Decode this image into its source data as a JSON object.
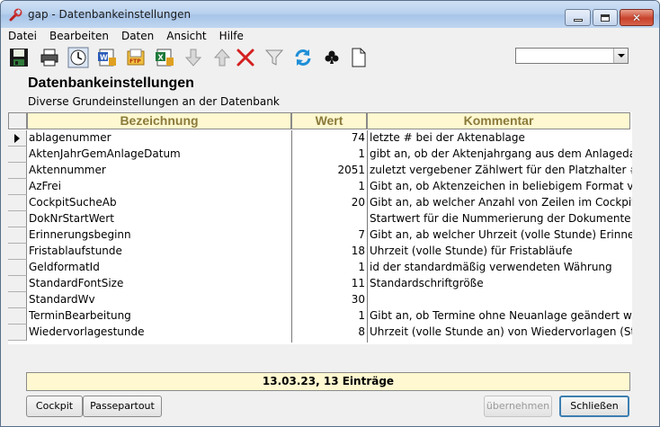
{
  "window": {
    "title": "gap - Datenbankeinstellungen",
    "icon": "wrench-icon"
  },
  "menu": [
    "Datei",
    "Bearbeiten",
    "Daten",
    "Ansicht",
    "Hilfe"
  ],
  "toolbar_icons": [
    "save-icon",
    "print-icon",
    "clock-icon",
    "word-export-icon",
    "ftp-icon",
    "excel-export-icon",
    "move-down-icon",
    "move-up-icon",
    "delete-icon",
    "filter-icon",
    "refresh-icon",
    "club-icon",
    "new-document-icon"
  ],
  "combo": {
    "value": ""
  },
  "page": {
    "title": "Datenbankeinstellungen",
    "subtitle": "Diverse Grundeinstellungen an der Datenbank"
  },
  "grid": {
    "columns": [
      "Bezeichnung",
      "Wert",
      "Kommentar"
    ],
    "rows": [
      {
        "name": "ablagenummer",
        "value": "74",
        "comment": "letzte # bei der Aktenablage"
      },
      {
        "name": "AktenJahrGemAnlageDatum",
        "value": "1",
        "comment": "gibt an, ob der Aktenjahrgang aus dem Anlagedatum"
      },
      {
        "name": "Aktennummer",
        "value": "2051",
        "comment": "zuletzt vergebener Zählwert für den Platzhalter # bei de"
      },
      {
        "name": "AzFrei",
        "value": "1",
        "comment": "Gibt an, ob Aktenzeichen in beliebigem Format verwer"
      },
      {
        "name": "CockpitSucheAb",
        "value": "20",
        "comment": "Gibt an, ab welcher Anzahl von Zeilen im Cockpit das"
      },
      {
        "name": "DokNrStartWert",
        "value": "",
        "comment": "Startwert für die Nummerierung der Dokumente im Ak"
      },
      {
        "name": "Erinnerungsbeginn",
        "value": "7",
        "comment": "Gibt an, ab welcher Uhrzeit (volle Stunde) Erinnerunge"
      },
      {
        "name": "Fristablaufstunde",
        "value": "18",
        "comment": "Uhrzeit (volle Stunde) für  Fristabläufe"
      },
      {
        "name": "GeldformatId",
        "value": "1",
        "comment": "id der standardmäßig verwendeten Währung"
      },
      {
        "name": "StandardFontSize",
        "value": "11",
        "comment": "Standardschriftgröße"
      },
      {
        "name": "StandardWv",
        "value": "30",
        "comment": ""
      },
      {
        "name": "TerminBearbeitung",
        "value": "1",
        "comment": "Gibt an, ob Termine ohne Neuanlage geändert werde"
      },
      {
        "name": "Wiedervorlagestunde",
        "value": "8",
        "comment": "Uhrzeit (volle Stunde an) von Wiedervorlagen (Standar"
      }
    ]
  },
  "status": "13.03.23, 13 Einträge",
  "buttons": {
    "cockpit": "Cockpit",
    "passepartout": "Passepartout",
    "apply": "übernehmen",
    "close": "Schließen"
  },
  "colors": {
    "header_bg": "#fff8d0",
    "header_text": "#8a7a3a",
    "close_border": "#3c7fb1"
  }
}
